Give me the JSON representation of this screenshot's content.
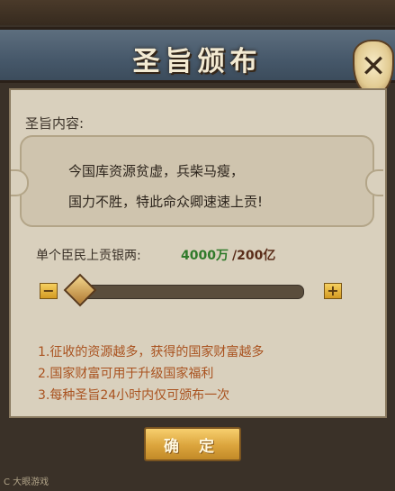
{
  "header": {
    "title": "圣旨颁布"
  },
  "content": {
    "label": "圣旨内容:",
    "lines": [
      "今国库资源贫虚，兵柴马瘦，",
      "国力不胜，特此命众卿速速上贡!"
    ]
  },
  "silver": {
    "label": "单个臣民上贡银两:",
    "current": "4000万",
    "max": "/200亿"
  },
  "slider": {
    "value_fraction": 0.0,
    "minus": "−",
    "plus": "+"
  },
  "tips": [
    "1.征收的资源越多，获得的国家财富越多",
    "2.国家财富可用于升级国家福利",
    "3.每种圣旨24小时内仅可颁布一次"
  ],
  "confirm_label": "确 定",
  "close_icon": "close-icon",
  "close_glyph": "✕",
  "watermark": "C 大眼游戏"
}
